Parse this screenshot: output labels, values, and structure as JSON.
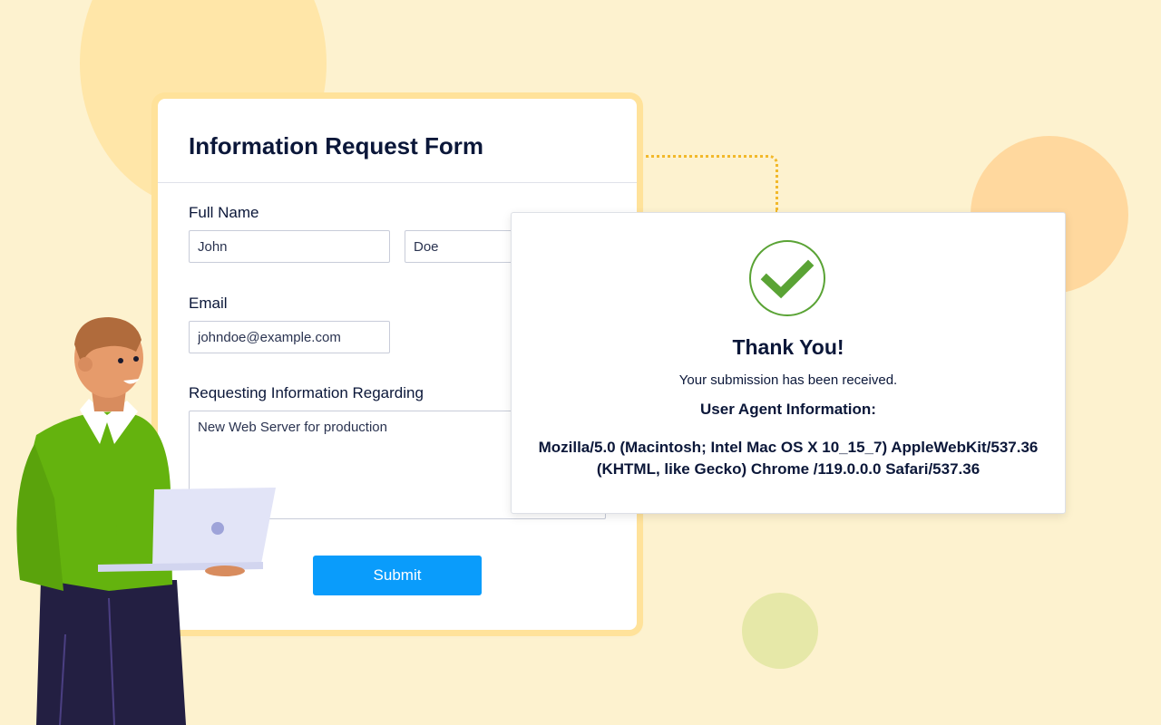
{
  "form": {
    "title": "Information Request Form",
    "full_name_label": "Full Name",
    "first_name_value": "John",
    "last_name_value": "Doe",
    "email_label": "Email",
    "email_value": "johndoe@example.com",
    "request_label": "Requesting Information Regarding",
    "request_value": "New Web Server for production",
    "submit_label": "Submit"
  },
  "confirmation": {
    "icon": "check-circle-icon",
    "title": "Thank You!",
    "message": "Your submission has been received.",
    "ua_heading": "User Agent Information:",
    "ua_line1": "Mozilla/5.0 (Macintosh; Intel Mac OS X 10_15_7) AppleWebKit/537.36",
    "ua_line2": "(KHTML, like Gecko) Chrome /119.0.0.0 Safari/537.36"
  },
  "colors": {
    "background": "#fdf2cf",
    "accent": "#0a9cfb",
    "success": "#5aa335",
    "text": "#0b1739"
  }
}
